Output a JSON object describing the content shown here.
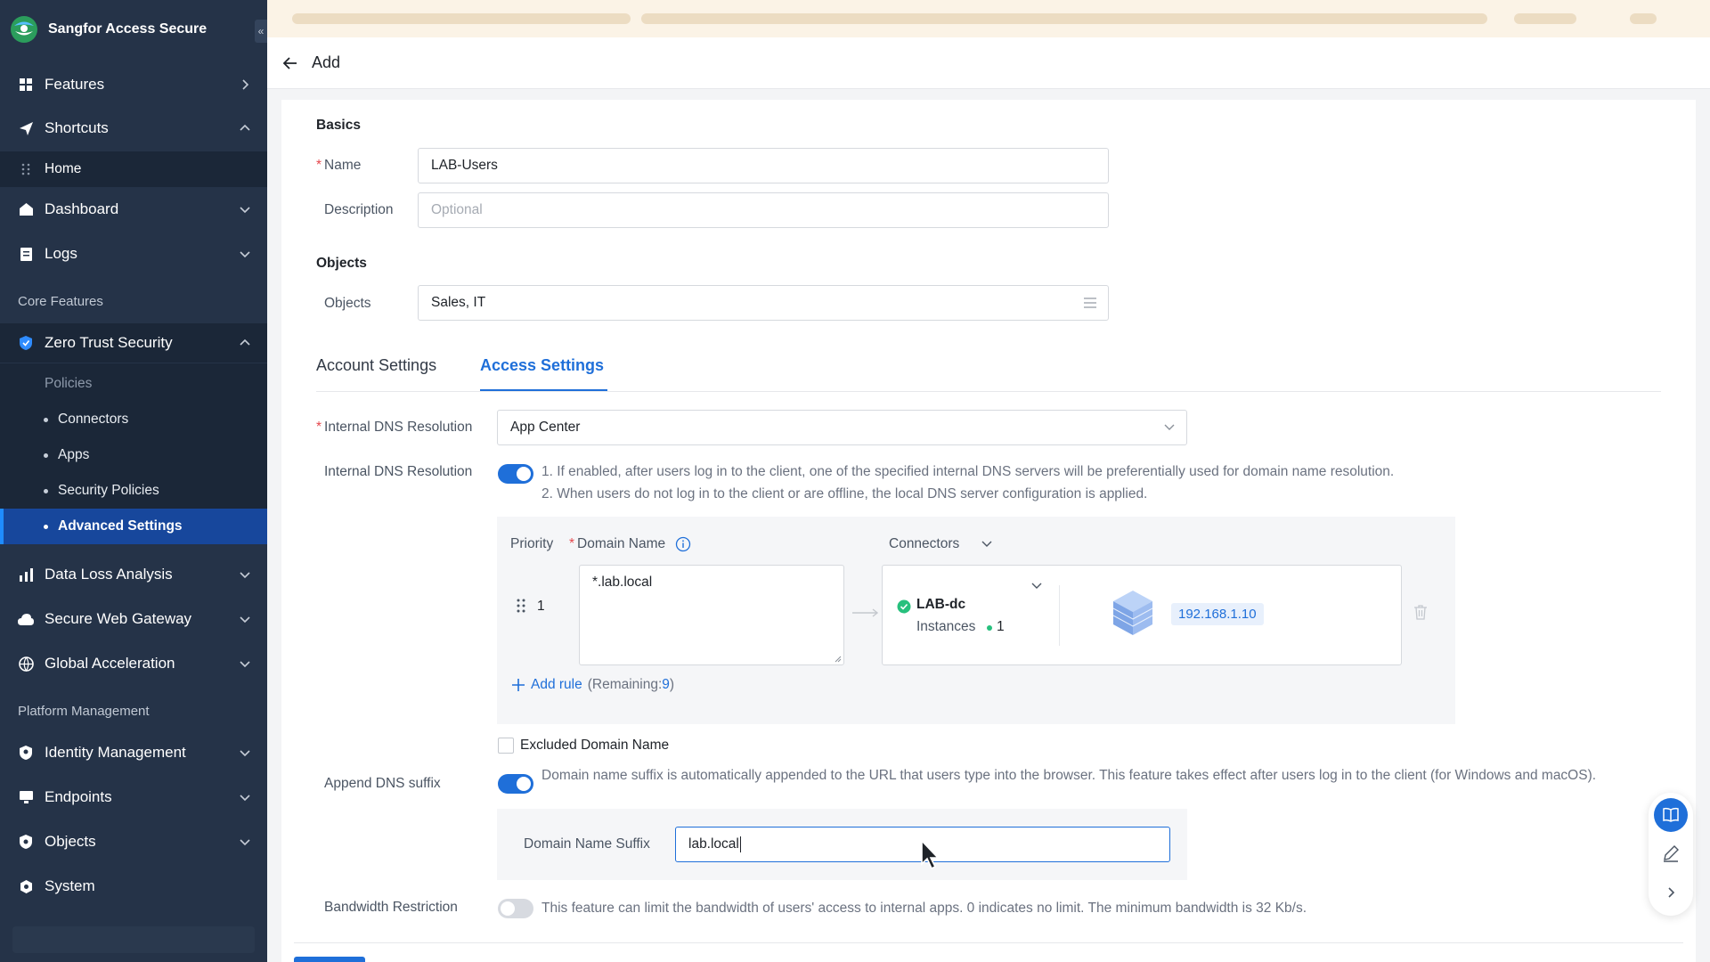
{
  "app": {
    "title": "Sangfor Access Secure",
    "colors": {
      "sidebar": "#253348",
      "accent": "#1f6fd9",
      "active_item": "#17479c",
      "required": "#e5484d",
      "success": "#27c07d"
    }
  },
  "sidebar": {
    "features": "Features",
    "shortcuts": "Shortcuts",
    "home": "Home",
    "dashboard": "Dashboard",
    "logs": "Logs",
    "core_features": "Core Features",
    "zero_trust": "Zero Trust Security",
    "policies": "Policies",
    "connectors": "Connectors",
    "apps": "Apps",
    "security_policies": "Security Policies",
    "advanced_settings": "Advanced Settings",
    "data_loss": "Data Loss Analysis",
    "secure_web_gateway": "Secure Web Gateway",
    "global_acceleration": "Global Acceleration",
    "platform_management": "Platform Management",
    "identity_management": "Identity Management",
    "endpoints": "Endpoints",
    "objects": "Objects",
    "system": "System"
  },
  "header": {
    "title": "Add"
  },
  "basics": {
    "heading": "Basics",
    "name_label": "Name",
    "name_value": "LAB-Users",
    "description_label": "Description",
    "description_placeholder": "Optional"
  },
  "objects": {
    "heading": "Objects",
    "label": "Objects",
    "value": "Sales, IT"
  },
  "tabs": {
    "account": "Account Settings",
    "access": "Access Settings"
  },
  "dns": {
    "resolution_label": "Internal DNS Resolution",
    "resolution_value": "App Center",
    "toggle_label": "Internal DNS Resolution",
    "help_1": "1. If enabled, after users log in to the client, one of the specified internal DNS servers will be preferentially used for domain name resolution.",
    "help_2": "2. When users do not log in to the client or are offline, the local DNS server configuration is applied.",
    "col_priority": "Priority",
    "col_domain": "Domain Name",
    "col_connectors": "Connectors",
    "rule_priority": "1",
    "rule_domain": "*.lab.local",
    "connector_name": "LAB-dc",
    "instances_label": "Instances",
    "instances_count": "1",
    "ip": "192.168.1.10",
    "add_rule": "Add rule",
    "remaining_prefix": "(Remaining: ",
    "remaining_count": "9",
    "remaining_suffix": " )",
    "excluded_label": "Excluded Domain Name"
  },
  "suffix": {
    "label": "Append DNS suffix",
    "help": "Domain name suffix is automatically appended to the URL that users type into the browser. This feature takes effect after users log in to the client (for Windows and macOS).",
    "field_label": "Domain Name Suffix",
    "field_value": "lab.local"
  },
  "bandwidth": {
    "label": "Bandwidth Restriction",
    "help": "This feature can limit the bandwidth of users' access to internal apps. 0 indicates no limit. The minimum bandwidth is 32 Kb/s."
  }
}
